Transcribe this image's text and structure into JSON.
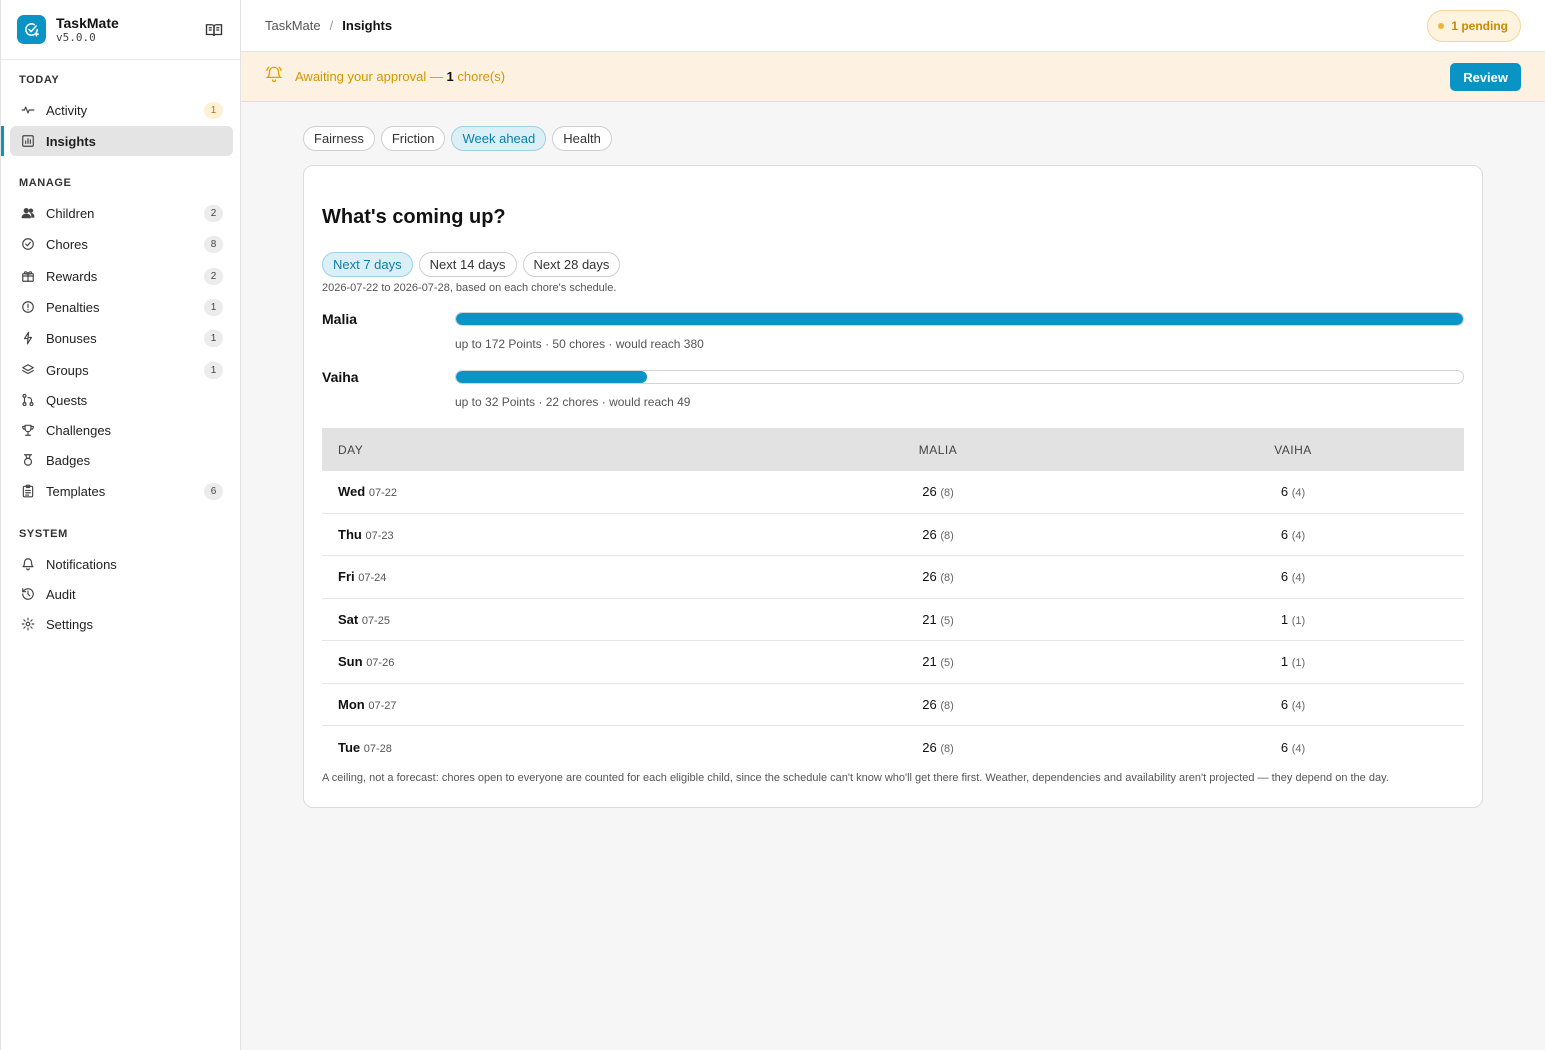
{
  "app": {
    "name": "TaskMate",
    "version": "v5.0.0"
  },
  "sidebar": {
    "sections": [
      {
        "heading": "TODAY",
        "items": [
          {
            "label": "Activity",
            "icon": "activity-icon",
            "count": "1",
            "warn": true
          },
          {
            "label": "Insights",
            "icon": "chart-icon",
            "count": "",
            "active": true
          }
        ]
      },
      {
        "heading": "MANAGE",
        "items": [
          {
            "label": "Children",
            "icon": "users-icon",
            "count": "2"
          },
          {
            "label": "Chores",
            "icon": "check-circle-icon",
            "count": "8"
          },
          {
            "label": "Rewards",
            "icon": "gift-icon",
            "count": "2"
          },
          {
            "label": "Penalties",
            "icon": "alert-circle-icon",
            "count": "1"
          },
          {
            "label": "Bonuses",
            "icon": "bolt-icon",
            "count": "1"
          },
          {
            "label": "Groups",
            "icon": "layers-icon",
            "count": "1"
          },
          {
            "label": "Quests",
            "icon": "route-icon",
            "count": ""
          },
          {
            "label": "Challenges",
            "icon": "trophy-icon",
            "count": ""
          },
          {
            "label": "Badges",
            "icon": "medal-icon",
            "count": ""
          },
          {
            "label": "Templates",
            "icon": "clipboard-icon",
            "count": "6"
          }
        ]
      },
      {
        "heading": "SYSTEM",
        "items": [
          {
            "label": "Notifications",
            "icon": "bell-icon",
            "count": ""
          },
          {
            "label": "Audit",
            "icon": "history-icon",
            "count": ""
          },
          {
            "label": "Settings",
            "icon": "gear-icon",
            "count": ""
          }
        ]
      }
    ]
  },
  "topbar": {
    "crumb_root": "TaskMate",
    "crumb_sep": "/",
    "crumb_current": "Insights",
    "pending_label": "1 pending"
  },
  "banner": {
    "text_before": "Awaiting your approval — ",
    "count": "1",
    "text_after": " chore(s)",
    "review_label": "Review"
  },
  "tabs": [
    {
      "label": "Fairness",
      "active": false
    },
    {
      "label": "Friction",
      "active": false
    },
    {
      "label": "Week ahead",
      "active": true
    },
    {
      "label": "Health",
      "active": false
    }
  ],
  "card": {
    "title": "What's coming up?",
    "ranges": [
      {
        "label": "Next 7 days",
        "active": true
      },
      {
        "label": "Next 14 days",
        "active": false
      },
      {
        "label": "Next 28 days",
        "active": false
      }
    ],
    "range_note": "2026-07-22 to 2026-07-28, based on each chore's schedule.",
    "kids": [
      {
        "name": "Malia",
        "fill_fraction": 1.0,
        "meta": "up to 172 Points · 50 chores · would reach 380"
      },
      {
        "name": "Vaiha",
        "fill_fraction": 0.19,
        "meta": "up to 32 Points · 22 chores · would reach 49"
      }
    ],
    "table": {
      "headers": [
        "DAY",
        "MALIA",
        "VAIHA"
      ],
      "rows": [
        {
          "day": "Wed",
          "date": "07-22",
          "a": "26",
          "a_sub": "(8)",
          "b": "6",
          "b_sub": "(4)"
        },
        {
          "day": "Thu",
          "date": "07-23",
          "a": "26",
          "a_sub": "(8)",
          "b": "6",
          "b_sub": "(4)"
        },
        {
          "day": "Fri",
          "date": "07-24",
          "a": "26",
          "a_sub": "(8)",
          "b": "6",
          "b_sub": "(4)"
        },
        {
          "day": "Sat",
          "date": "07-25",
          "a": "21",
          "a_sub": "(5)",
          "b": "1",
          "b_sub": "(1)"
        },
        {
          "day": "Sun",
          "date": "07-26",
          "a": "21",
          "a_sub": "(5)",
          "b": "1",
          "b_sub": "(1)"
        },
        {
          "day": "Mon",
          "date": "07-27",
          "a": "26",
          "a_sub": "(8)",
          "b": "6",
          "b_sub": "(4)"
        },
        {
          "day": "Tue",
          "date": "07-28",
          "a": "26",
          "a_sub": "(8)",
          "b": "6",
          "b_sub": "(4)"
        }
      ]
    },
    "footnote": "A ceiling, not a forecast: chores open to everyone are counted for each eligible child, since the schedule can't know who'll get there first. Weather, dependencies and availability aren't projected — they depend on the day."
  },
  "colors": {
    "accent": "#0a94c6",
    "warn": "#d59400"
  }
}
